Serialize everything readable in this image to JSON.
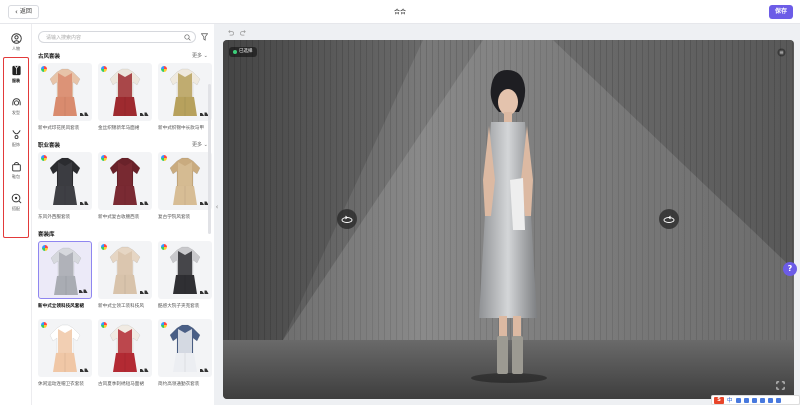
{
  "topbar": {
    "back_label": "返回",
    "title": "合合",
    "save_label": "保存"
  },
  "rail": {
    "items": [
      {
        "label": "人物",
        "icon": "person-icon"
      },
      {
        "label": "服装",
        "icon": "clothing-icon"
      },
      {
        "label": "发型",
        "icon": "hair-icon"
      },
      {
        "label": "配饰",
        "icon": "necklace-icon"
      },
      {
        "label": "鞋包",
        "icon": "bag-icon"
      },
      {
        "label": "搭配",
        "icon": "search-outfit-icon"
      }
    ],
    "active_index": 1
  },
  "panel": {
    "search_placeholder": "请输入搜索内容",
    "sections": [
      {
        "title": "古风套装",
        "more": "更多",
        "cards": [
          {
            "label": "新中式印花民风套装",
            "color": "#d98b6e",
            "accent": "#e7c3a8"
          },
          {
            "label": "金丝织锦新年马面裙",
            "color": "#9e2a2f",
            "accent": "#ece6dc"
          },
          {
            "label": "新中式织锦中长款马甲",
            "color": "#b7a15d",
            "accent": "#efe9de"
          }
        ]
      },
      {
        "title": "职业套装",
        "more": "更多",
        "cards": [
          {
            "label": "东风外西服套装",
            "color": "#3e3f44",
            "accent": "#2b2c30"
          },
          {
            "label": "新中式复古收腰西装",
            "color": "#7a2a33",
            "accent": "#6a222a"
          },
          {
            "label": "复古学院风套装",
            "color": "#d7bd95",
            "accent": "#c9ab7f"
          }
        ]
      },
      {
        "title": "套装库",
        "more": "",
        "cards": [
          {
            "label": "新中式立领科技风套裙",
            "color": "#a9acb3",
            "accent": "#d6d8dd",
            "selected": true
          },
          {
            "label": "新中式立领工装科技风",
            "color": "#d8c3ab",
            "accent": "#e6d6c4"
          },
          {
            "label": "酷感大院子夹克套装",
            "color": "#2f2f33",
            "accent": "#c9c9cc"
          },
          {
            "label": "休闲运动连帽卫衣套装",
            "color": "#f0c7a6",
            "accent": "#ffffff"
          },
          {
            "label": "古风夏季刺绣短马面裙",
            "color": "#b32a33",
            "accent": "#f1ebe3"
          },
          {
            "label": "简约高领通勤衣套装",
            "color": "#eceef2",
            "accent": "#4a5f86"
          }
        ]
      }
    ]
  },
  "canvas": {
    "badge": "已选择",
    "rotate_left_icon": "rotate-icon",
    "rotate_right_icon": "rotate-icon",
    "dress_color": "#b9bbbd",
    "backdrop_color": "#6b6b6b"
  },
  "help_label": "?",
  "ime": {
    "logo": "S",
    "mode": "中"
  },
  "colors": {
    "accent": "#6c5ce7",
    "highlight": "#e23a3a"
  }
}
